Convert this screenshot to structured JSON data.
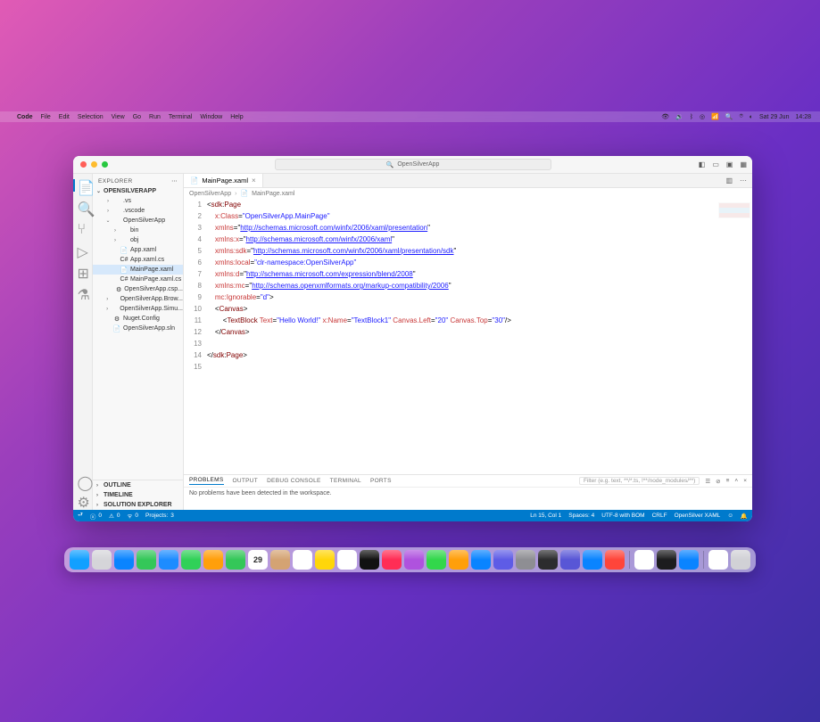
{
  "menubar": {
    "apple": "",
    "app": "Code",
    "items": [
      "File",
      "Edit",
      "Selection",
      "View",
      "Go",
      "Run",
      "Terminal",
      "Window",
      "Help"
    ],
    "right_date": "Sat 29 Jun",
    "right_time": "14:28"
  },
  "window": {
    "search_placeholder": "OpenSilverApp",
    "search_icon": "🔍"
  },
  "sidebar": {
    "header": "EXPLORER",
    "root": "OPENSILVERAPP",
    "tree": [
      {
        "label": ".vs",
        "type": "folder",
        "open": false,
        "indent": 1
      },
      {
        "label": ".vscode",
        "type": "folder",
        "open": false,
        "indent": 1
      },
      {
        "label": "OpenSilverApp",
        "type": "folder",
        "open": true,
        "indent": 1
      },
      {
        "label": "bin",
        "type": "folder",
        "open": false,
        "indent": 2
      },
      {
        "label": "obj",
        "type": "folder",
        "open": false,
        "indent": 2
      },
      {
        "label": "App.xaml",
        "type": "file",
        "icon": "📄",
        "indent": 2
      },
      {
        "label": "App.xaml.cs",
        "type": "file",
        "icon": "C#",
        "indent": 2
      },
      {
        "label": "MainPage.xaml",
        "type": "file",
        "icon": "📄",
        "indent": 2,
        "selected": true
      },
      {
        "label": "MainPage.xaml.cs",
        "type": "file",
        "icon": "C#",
        "indent": 2
      },
      {
        "label": "OpenSilverApp.csp...",
        "type": "file",
        "icon": "⚙",
        "indent": 2
      },
      {
        "label": "OpenSilverApp.Brow...",
        "type": "folder",
        "open": false,
        "indent": 1
      },
      {
        "label": "OpenSilverApp.Simu...",
        "type": "folder",
        "open": false,
        "indent": 1
      },
      {
        "label": "Nuget.Config",
        "type": "file",
        "icon": "⚙",
        "indent": 1
      },
      {
        "label": "OpenSilverApp.sln",
        "type": "file",
        "icon": "📄",
        "indent": 1
      }
    ],
    "bottom_sections": [
      "OUTLINE",
      "TIMELINE",
      "SOLUTION EXPLORER"
    ]
  },
  "tabs": {
    "open": [
      {
        "label": "MainPage.xaml",
        "icon": "📄"
      }
    ]
  },
  "breadcrumb": {
    "parts": [
      "OpenSilverApp",
      "MainPage.xaml"
    ]
  },
  "editor": {
    "line_count": 15,
    "lines_html": [
      "<span class='t-op'>&lt;</span><span class='t-tag'>sdk</span><span class='t-op'>:</span><span class='t-tag'>Page</span>",
      "    <span class='t-attr'>x:Class</span><span class='t-op'>=</span><span class='t-str'>\"OpenSilverApp.MainPage\"</span>",
      "    <span class='t-attr'>xmlns</span><span class='t-op'>=</span><span class='t-op'>\"</span><span class='t-link'>http://schemas.microsoft.com/winfx/2006/xaml/presentation</span><span class='t-op'>\"</span>",
      "    <span class='t-attr'>xmlns:x</span><span class='t-op'>=</span><span class='t-op'>\"</span><span class='t-link'>http://schemas.microsoft.com/winfx/2006/xaml</span><span class='t-op'>\"</span>",
      "    <span class='t-attr'>xmlns:sdk</span><span class='t-op'>=</span><span class='t-op'>\"</span><span class='t-link'>http://schemas.microsoft.com/winfx/2006/xaml/presentation/sdk</span><span class='t-op'>\"</span>",
      "    <span class='t-attr'>xmlns:local</span><span class='t-op'>=</span><span class='t-str'>\"clr-namespace:OpenSilverApp\"</span>",
      "    <span class='t-attr'>xmlns:d</span><span class='t-op'>=</span><span class='t-op'>\"</span><span class='t-link'>http://schemas.microsoft.com/expression/blend/2008</span><span class='t-op'>\"</span>",
      "    <span class='t-attr'>xmlns:mc</span><span class='t-op'>=</span><span class='t-op'>\"</span><span class='t-link'>http://schemas.openxmlformats.org/markup-compatibility/2006</span><span class='t-op'>\"</span>",
      "    <span class='t-attr'>mc:Ignorable</span><span class='t-op'>=</span><span class='t-str'>\"d\"</span><span class='t-op'>&gt;</span>",
      "    <span class='t-op'>&lt;</span><span class='t-tag'>Canvas</span><span class='t-op'>&gt;</span>",
      "        <span class='t-op'>&lt;</span><span class='t-tag'>TextBlock</span> <span class='t-attr'>Text</span><span class='t-op'>=</span><span class='t-str'>\"Hello World!\"</span> <span class='t-attr'>x:Name</span><span class='t-op'>=</span><span class='t-str'>\"TextBlock1\"</span> <span class='t-attr'>Canvas.Left</span><span class='t-op'>=</span><span class='t-str'>\"20\"</span> <span class='t-attr'>Canvas.Top</span><span class='t-op'>=</span><span class='t-str'>\"30\"</span><span class='t-op'>/&gt;</span>",
      "    <span class='t-op'>&lt;/</span><span class='t-tag'>Canvas</span><span class='t-op'>&gt;</span>",
      " ",
      "<span class='t-op'>&lt;/</span><span class='t-tag'>sdk</span><span class='t-op'>:</span><span class='t-tag'>Page</span><span class='t-op'>&gt;</span>",
      " "
    ]
  },
  "panel": {
    "tabs": [
      "PROBLEMS",
      "OUTPUT",
      "DEBUG CONSOLE",
      "TERMINAL",
      "PORTS"
    ],
    "filter_placeholder": "Filter (e.g. text, **/*.ts, !**/node_modules/**)",
    "body": "No problems have been detected in the workspace."
  },
  "status": {
    "left": {
      "errors": "0",
      "warnings": "0",
      "projects_label": "Projects:",
      "projects": "3",
      "ports": "0"
    },
    "right": {
      "lncol": "Ln 15, Col 1",
      "spaces": "Spaces: 4",
      "encoding": "UTF-8 with BOM",
      "eol": "CRLF",
      "lang": "OpenSilver XAML"
    }
  },
  "dock": {
    "apps": [
      {
        "name": "finder",
        "color": "#12a0ff"
      },
      {
        "name": "launchpad",
        "color": "#d5d5d9"
      },
      {
        "name": "safari",
        "color": "#0a84ff"
      },
      {
        "name": "messages",
        "color": "#34c759"
      },
      {
        "name": "mail",
        "color": "#1d8cff"
      },
      {
        "name": "maps",
        "color": "#30d158"
      },
      {
        "name": "photos",
        "color": "#ff9f0a"
      },
      {
        "name": "facetime",
        "color": "#34c759"
      },
      {
        "name": "calendar",
        "color": "#ffffff",
        "text": "29"
      },
      {
        "name": "contacts",
        "color": "#d4a373"
      },
      {
        "name": "reminders",
        "color": "#ffffff"
      },
      {
        "name": "notes",
        "color": "#ffd60a"
      },
      {
        "name": "freeform",
        "color": "#ffffff"
      },
      {
        "name": "tv",
        "color": "#111111"
      },
      {
        "name": "music",
        "color": "#ff2d55"
      },
      {
        "name": "podcasts",
        "color": "#af52de"
      },
      {
        "name": "numbers",
        "color": "#32d74b"
      },
      {
        "name": "pages",
        "color": "#ff9f0a"
      },
      {
        "name": "appstore",
        "color": "#0a84ff"
      },
      {
        "name": "safari-tech",
        "color": "#5e5ce6"
      },
      {
        "name": "help",
        "color": "#8e8e93"
      },
      {
        "name": "screenshots",
        "color": "#2c2c2e"
      },
      {
        "name": "tool-a",
        "color": "#5856d6"
      },
      {
        "name": "tool-b",
        "color": "#0a84ff"
      },
      {
        "name": "tool-c",
        "color": "#ff453a"
      }
    ],
    "apps_right": [
      {
        "name": "chrome",
        "color": "#ffffff"
      },
      {
        "name": "terminal",
        "color": "#1c1c1e"
      },
      {
        "name": "vscode",
        "color": "#0a84ff"
      }
    ],
    "apps_far": [
      {
        "name": "downloads",
        "color": "#ffffff"
      },
      {
        "name": "trash",
        "color": "#d1d1d6"
      }
    ]
  }
}
